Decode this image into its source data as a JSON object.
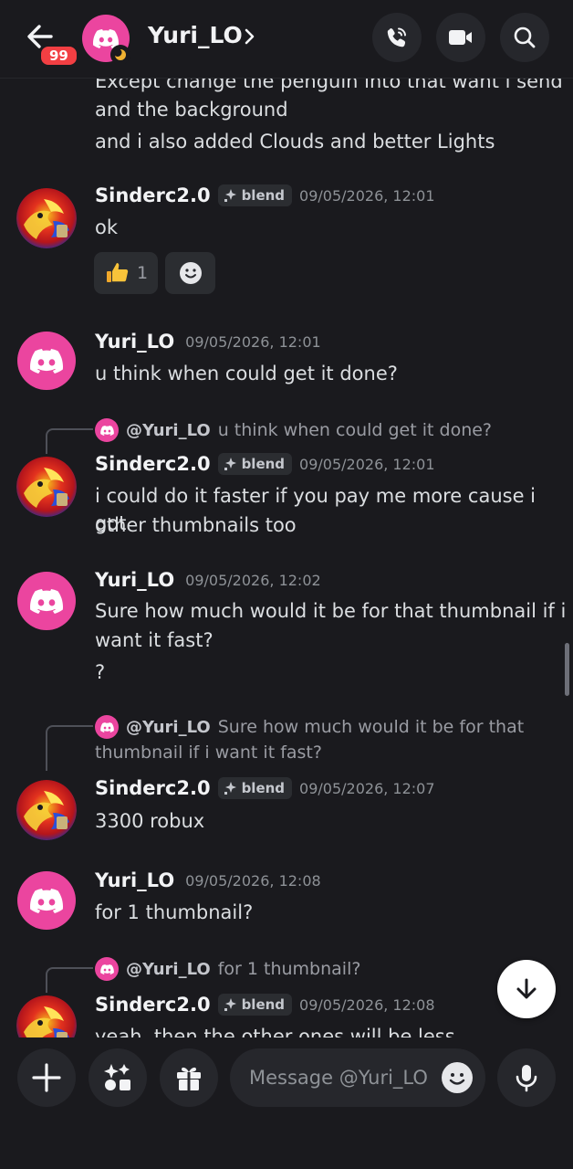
{
  "header": {
    "badge_count": "99",
    "title": "Yuri_LO"
  },
  "messages": {
    "m0": {
      "line1": "Except change the penguin into that want i send",
      "line2": "and the background",
      "line3": "and i also added Clouds and better Lights"
    },
    "m1": {
      "author": "Sinderc2.0",
      "tag": "blend",
      "time": "09/05/2026, 12:01",
      "text": "ok",
      "reaction_count": "1"
    },
    "m2": {
      "author": "Yuri_LO",
      "time": "09/05/2026, 12:01",
      "text": "u think when could get it done?"
    },
    "m3": {
      "reply_name": "@Yuri_LO",
      "reply_text": "u think when could get it done?",
      "author": "Sinderc2.0",
      "tag": "blend",
      "time": "09/05/2026, 12:01",
      "line1": "i could do it faster if you pay me more cause i got",
      "line2": "other thumbnails too"
    },
    "m4": {
      "author": "Yuri_LO",
      "time": "09/05/2026, 12:02",
      "line1": "Sure how much would it be for that thumbnail if i",
      "line2": "want it fast?",
      "line3": "?"
    },
    "m5": {
      "reply_name": "@Yuri_LO",
      "reply_line1": "Sure how much would it be for that",
      "reply_line2": "thumbnail if i want it fast?",
      "author": "Sinderc2.0",
      "tag": "blend",
      "time": "09/05/2026, 12:07",
      "text": "3300 robux"
    },
    "m6": {
      "author": "Yuri_LO",
      "time": "09/05/2026, 12:08",
      "text": "for 1 thumbnail?"
    },
    "m7": {
      "reply_name": "@Yuri_LO",
      "reply_text": "for 1 thumbnail?",
      "author": "Sinderc2.0",
      "tag": "blend",
      "time": "09/05/2026, 12:08",
      "text": "yeah, then the other ones will be less"
    }
  },
  "composer": {
    "placeholder": "Message @Yuri_LO"
  },
  "colors": {
    "background": "#1a1a1e",
    "brand_pink": "#eb459f",
    "badge_red": "#f23f43"
  },
  "icons": [
    "back-arrow-icon",
    "discord-logo-icon",
    "moon-status-icon",
    "chevron-right-icon",
    "phone-icon",
    "video-icon",
    "search-icon",
    "thumbs-up-icon",
    "add-reaction-icon",
    "arrow-down-icon",
    "plus-icon",
    "apps-icon",
    "gift-icon",
    "emoji-icon",
    "microphone-icon"
  ]
}
